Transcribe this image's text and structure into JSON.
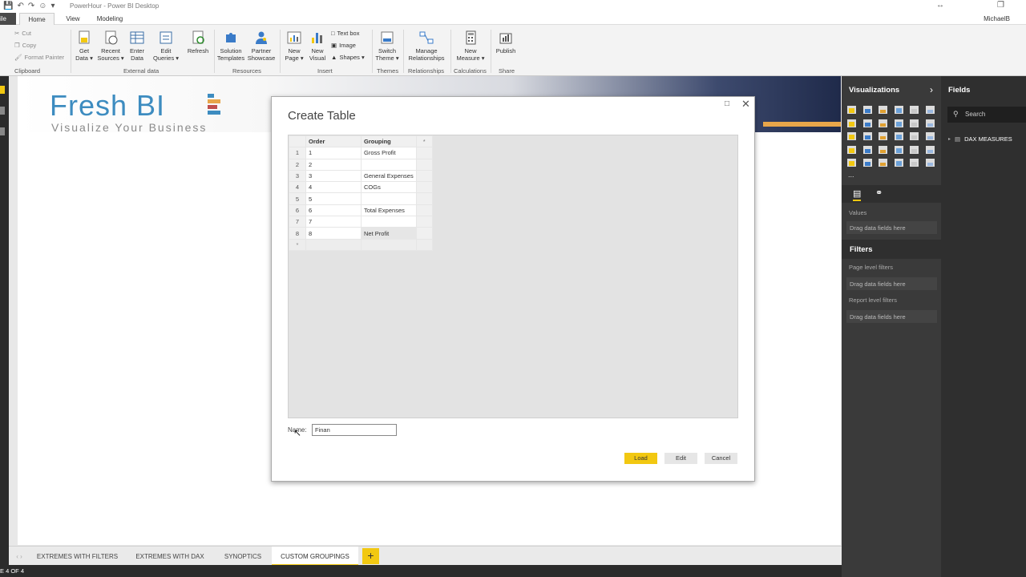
{
  "app": {
    "window_title": "PowerHour - Power BI Desktop",
    "user": "MichaelB"
  },
  "menu": {
    "file_label": "ile",
    "tabs": [
      "Home",
      "View",
      "Modeling"
    ],
    "active_tab": "Home"
  },
  "ribbon": {
    "clipboard": {
      "cut": "Cut",
      "copy": "Copy",
      "format_painter": "Format Painter",
      "group": "Clipboard"
    },
    "external_data": {
      "get_data": [
        "Get",
        "Data ▾"
      ],
      "recent_sources": [
        "Recent",
        "Sources ▾"
      ],
      "enter_data": [
        "Enter",
        "Data"
      ],
      "edit_queries": [
        "Edit",
        "Queries ▾"
      ],
      "refresh": "Refresh",
      "group": "External data"
    },
    "resources": {
      "solution_templates": [
        "Solution",
        "Templates"
      ],
      "partner_showcase": [
        "Partner",
        "Showcase"
      ],
      "group": "Resources"
    },
    "insert": {
      "new_page": [
        "New",
        "Page ▾"
      ],
      "new_visual": [
        "New",
        "Visual"
      ],
      "text_box": "Text box",
      "image": "Image",
      "shapes": "Shapes ▾",
      "group": "Insert"
    },
    "themes": {
      "switch_theme": [
        "Switch",
        "Theme ▾"
      ],
      "group": "Themes"
    },
    "relationships": {
      "manage": [
        "Manage",
        "Relationships"
      ],
      "group": "Relationships"
    },
    "calculations": {
      "new_measure": [
        "New",
        "Measure ▾"
      ],
      "group": "Calculations"
    },
    "share": {
      "publish": "Publish",
      "group": "Share"
    }
  },
  "logo": {
    "brand": "Fresh BI",
    "tagline": "Visualize Your Business"
  },
  "dialog": {
    "title": "Create Table",
    "columns": [
      "Order",
      "Grouping",
      "*"
    ],
    "rows": [
      {
        "n": "1",
        "order": "1",
        "grouping": "Gross Profit"
      },
      {
        "n": "2",
        "order": "2",
        "grouping": ""
      },
      {
        "n": "3",
        "order": "3",
        "grouping": "General Expenses"
      },
      {
        "n": "4",
        "order": "4",
        "grouping": "COGs"
      },
      {
        "n": "5",
        "order": "5",
        "grouping": ""
      },
      {
        "n": "6",
        "order": "6",
        "grouping": "Total Expenses"
      },
      {
        "n": "7",
        "order": "7",
        "grouping": ""
      },
      {
        "n": "8",
        "order": "8",
        "grouping": "Net Profit"
      }
    ],
    "new_row_marker": "*",
    "name_label": "Name:",
    "name_value": "Finan",
    "buttons": {
      "load": "Load",
      "edit": "Edit",
      "cancel": "Cancel"
    }
  },
  "pages": {
    "tabs": [
      "EXTREMES WITH FILTERS",
      "EXTREMES WITH DAX",
      "SYNOPTICS",
      "CUSTOM GROUPINGS"
    ],
    "active": "CUSTOM GROUPINGS",
    "add": "+"
  },
  "status": {
    "page_indicator": "E 4 OF 4"
  },
  "visualizations": {
    "title": "Visualizations",
    "more": "...",
    "values_label": "Values",
    "drag_here": "Drag data fields here",
    "filters_title": "Filters",
    "page_filters": "Page level filters",
    "report_filters": "Report level filters"
  },
  "fields": {
    "title": "Fields",
    "search_placeholder": "Search",
    "tables": [
      "DAX MEASURES"
    ]
  },
  "colors": {
    "accent": "#f2c811",
    "pane_dark": "#3a3a3a",
    "brand_blue": "#3d8cc0"
  }
}
